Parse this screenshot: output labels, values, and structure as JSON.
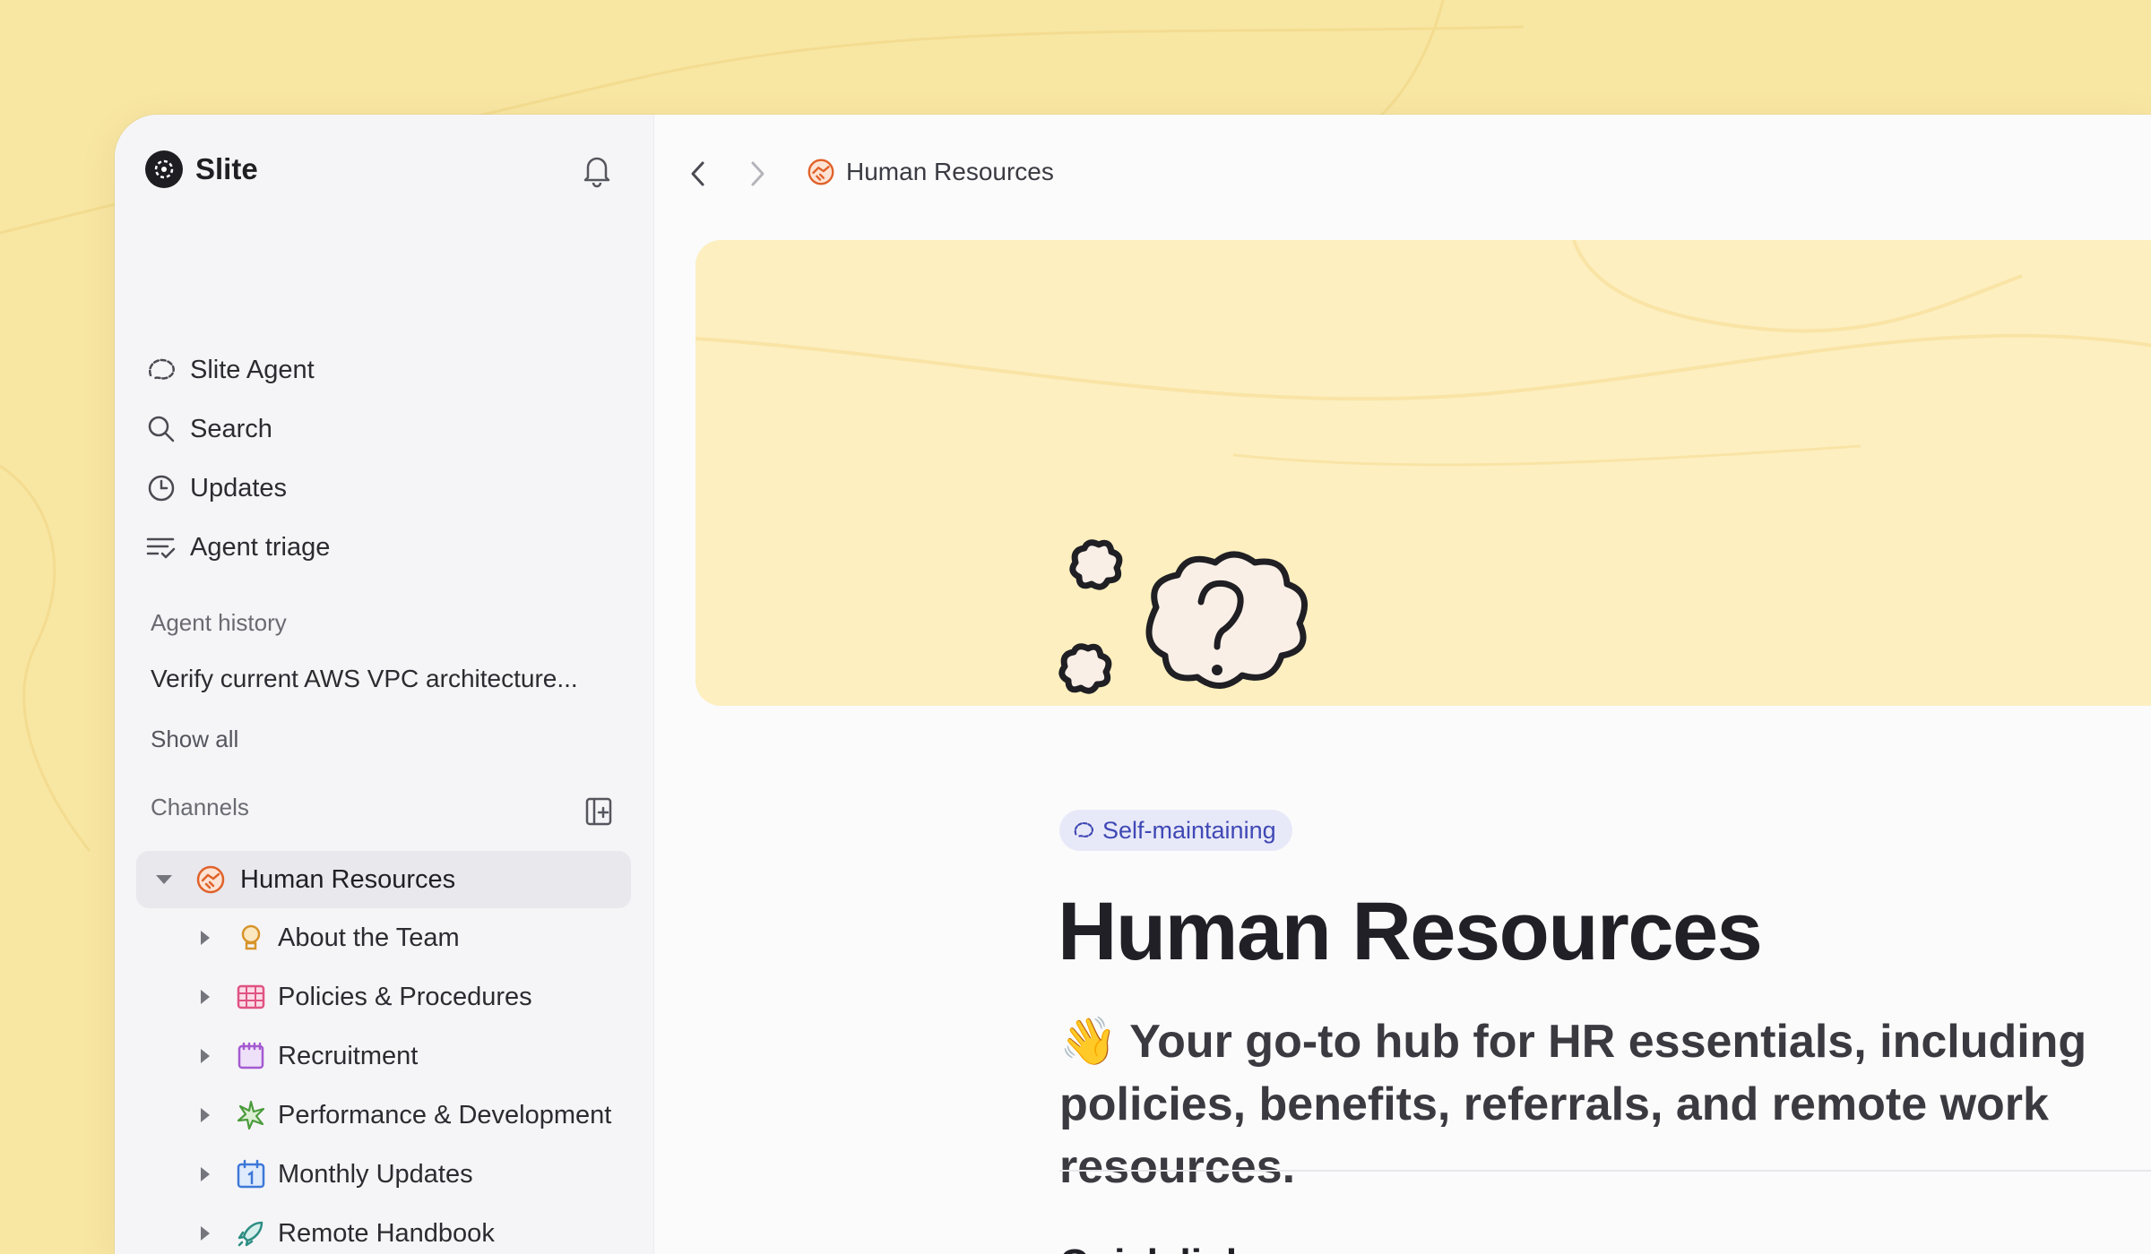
{
  "app": {
    "name": "Slite"
  },
  "sidebar": {
    "nav": [
      {
        "label": "Slite Agent",
        "icon": "agent-icon"
      },
      {
        "label": "Search",
        "icon": "search-icon"
      },
      {
        "label": "Updates",
        "icon": "clock-icon"
      },
      {
        "label": "Agent triage",
        "icon": "triage-icon"
      }
    ],
    "agent_history": {
      "title": "Agent history",
      "items": [
        "Verify current AWS VPC architecture..."
      ],
      "show_all": "Show all"
    },
    "channels": {
      "title": "Channels",
      "root": {
        "label": "Human Resources",
        "icon": "handshake-icon"
      },
      "children": [
        {
          "label": "About the Team",
          "icon": "bulb-icon",
          "color": "#d7942a"
        },
        {
          "label": "Policies & Procedures",
          "icon": "policy-icon",
          "color": "#e05383"
        },
        {
          "label": "Recruitment",
          "icon": "notepad-icon",
          "color": "#a45bd0"
        },
        {
          "label": "Performance & Development",
          "icon": "sparkle-icon",
          "color": "#4b9b3c"
        },
        {
          "label": "Monthly Updates",
          "icon": "calendar-icon",
          "color": "#3d78d8"
        },
        {
          "label": "Remote Handbook",
          "icon": "rocket-icon",
          "color": "#2c8d83"
        }
      ]
    }
  },
  "breadcrumb": {
    "label": "Human Resources"
  },
  "page": {
    "badge": "Self-maintaining",
    "title": "Human Resources",
    "subtitle_emoji": "👋",
    "subtitle": "Your go-to hub for HR essentials, including policies, benefits, referrals, and remote work resources.",
    "next_heading": "Quick links"
  },
  "colors": {
    "background": "#f8e6a3",
    "cover": "#fdefbf",
    "badge_bg": "#e8e9f8",
    "badge_text": "#3f48b5",
    "hr_icon": "#e0622a"
  }
}
